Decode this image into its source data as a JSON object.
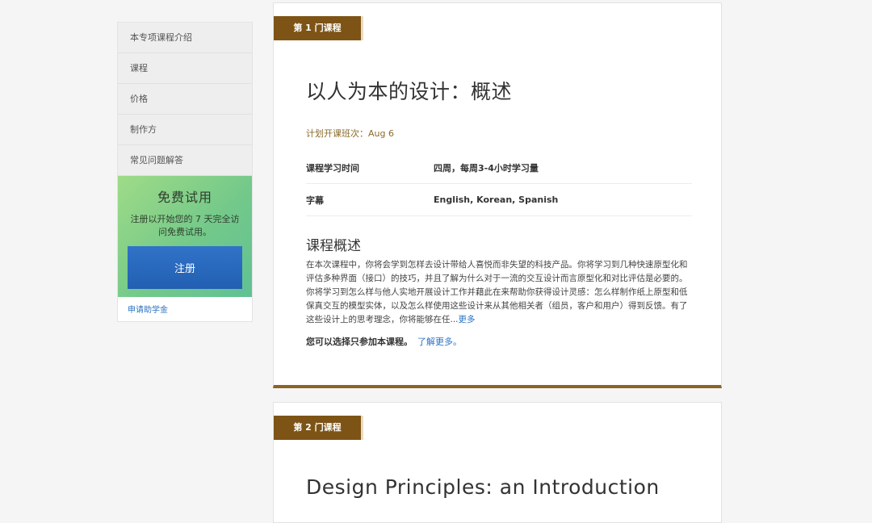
{
  "sidebar": {
    "nav": [
      {
        "label": "本专项课程介绍"
      },
      {
        "label": "课程"
      },
      {
        "label": "价格"
      },
      {
        "label": "制作方"
      },
      {
        "label": "常见问题解答"
      }
    ],
    "trial": {
      "title": "免费试用",
      "description": "注册以开始您的 7 天完全访问免费试用。",
      "button_label": "注册"
    },
    "scholarship_link": "申请助学金"
  },
  "courses": [
    {
      "tag": "第 1 门课程",
      "title": "以人为本的设计：概述",
      "session_label": "计划开课班次：Aug 6",
      "details": [
        {
          "key": "课程学习时间",
          "value": "四周，每周3-4小时学习量"
        },
        {
          "key": "字幕",
          "value": "English, Korean, Spanish"
        }
      ],
      "overview_title": "课程概述",
      "overview_text": "在本次课程中，你将会学到怎样去设计带给人喜悦而非失望的科技产品。你将学习到几种快速原型化和评估多种界面（接口）的技巧，并且了解为什么对于一流的交互设计而言原型化和对比评估是必要的。你将学习到怎么样与他人实地开展设计工作并藉此在来帮助你获得设计灵感：怎么样制作纸上原型和低保真交互的模型实体，以及怎么样使用这些设计来从其他相关者（组员，客户和用户）得到反馈。有了这些设计上的思考理念，你将能够在任...",
      "more_label": "更多",
      "option_text": "您可以选择只参加本课程。",
      "learn_more_label": "了解更多。"
    },
    {
      "tag": "第 2 门课程",
      "title": "Design Principles: an Introduction"
    }
  ],
  "colors": {
    "tag_bg": "#7d5416",
    "accent_border": "#8b6323",
    "link": "#2a73c3",
    "trial_button": "#2a67bd",
    "trial_bg": "#7fce8a"
  }
}
